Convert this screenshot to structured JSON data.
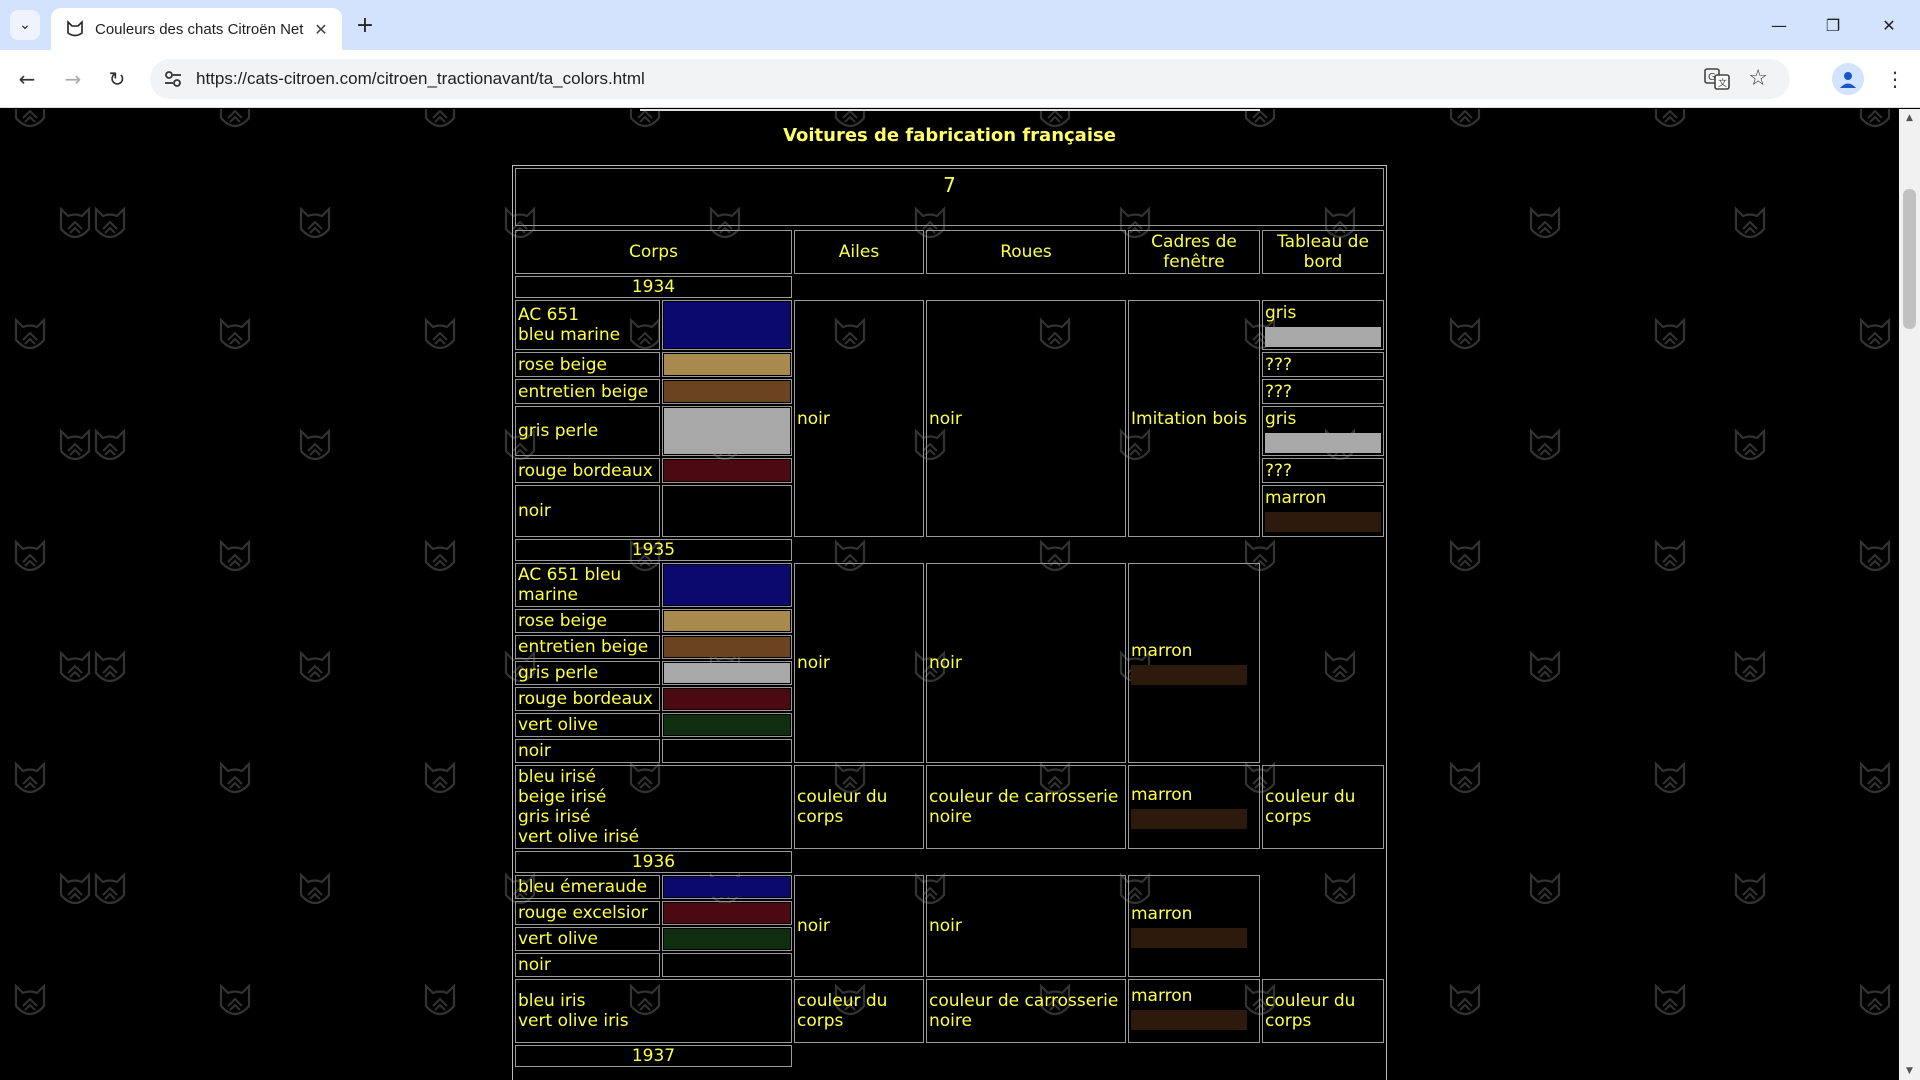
{
  "browser": {
    "tab_title": "Couleurs des chats Citroën Net",
    "url": "https://cats-citroen.com/citroen_tractionavant/ta_colors.html"
  },
  "page": {
    "heading": "Voitures de fabrication française",
    "table_number": "7",
    "headers": {
      "corps": "Corps",
      "ailes": "Ailes",
      "roues": "Roues",
      "cadres": "Cadres de fenêtre",
      "tableau": "Tableau de bord"
    },
    "y1934": {
      "year": "1934",
      "colors": [
        {
          "name": "AC 651\nbleu marine",
          "color": "#0a0a6e"
        },
        {
          "name": "rose beige",
          "color": "#a88a4e"
        },
        {
          "name": "entretien beige",
          "color": "#6a4420"
        },
        {
          "name": "gris perle",
          "color": "#a8a8a8"
        },
        {
          "name": "rouge bordeaux",
          "color": "#4a0a10"
        },
        {
          "name": "noir",
          "color": "#000000"
        }
      ],
      "ailes": "noir",
      "roues": "noir",
      "cadres": "Imitation bois",
      "tableau": [
        {
          "label": "gris",
          "color": "#a8a8a8"
        },
        {
          "label": "???",
          "color": ""
        },
        {
          "label": "???",
          "color": ""
        },
        {
          "label": "gris",
          "color": "#a8a8a8"
        },
        {
          "label": "???",
          "color": ""
        },
        {
          "label": "marron",
          "color": "#2e1a0c"
        }
      ]
    },
    "y1935": {
      "year": "1935",
      "colors": [
        {
          "name": "AC 651 bleu\nmarine",
          "color": "#0a0a6e"
        },
        {
          "name": "rose beige",
          "color": "#a88a4e"
        },
        {
          "name": "entretien beige",
          "color": "#6a4420"
        },
        {
          "name": "gris perle",
          "color": "#a8a8a8"
        },
        {
          "name": "rouge bordeaux",
          "color": "#4a0a10"
        },
        {
          "name": "vert olive",
          "color": "#0f2e0f"
        },
        {
          "name": "noir",
          "color": "#000000"
        }
      ],
      "ailes": "noir",
      "roues": "noir",
      "cadres": "marron",
      "cadres_color": "#2e1a0c",
      "irise": {
        "names": [
          "bleu irisé",
          "beige irisé",
          "gris irisé",
          "vert olive irisé"
        ],
        "ailes": "couleur du corps",
        "roues": "couleur de carrosserie noire",
        "cadres": "marron",
        "cadres_color": "#2e1a0c",
        "tableau": "couleur du corps"
      }
    },
    "y1936": {
      "year": "1936",
      "colors": [
        {
          "name": "bleu émeraude",
          "color": "#0a0a6e"
        },
        {
          "name": "rouge excelsior",
          "color": "#4a0a10"
        },
        {
          "name": "vert olive",
          "color": "#0f2e0f"
        },
        {
          "name": "noir",
          "color": "#000000"
        }
      ],
      "ailes": "noir",
      "roues": "noir",
      "cadres": "marron",
      "cadres_color": "#2e1a0c",
      "iris": {
        "names": [
          "bleu iris",
          "vert olive iris"
        ],
        "ailes": "couleur du corps",
        "roues": "couleur de carrosserie noire",
        "cadres": "marron",
        "cadres_color": "#2e1a0c",
        "tableau": "couleur du corps"
      }
    },
    "y1937": {
      "year": "1937"
    }
  }
}
